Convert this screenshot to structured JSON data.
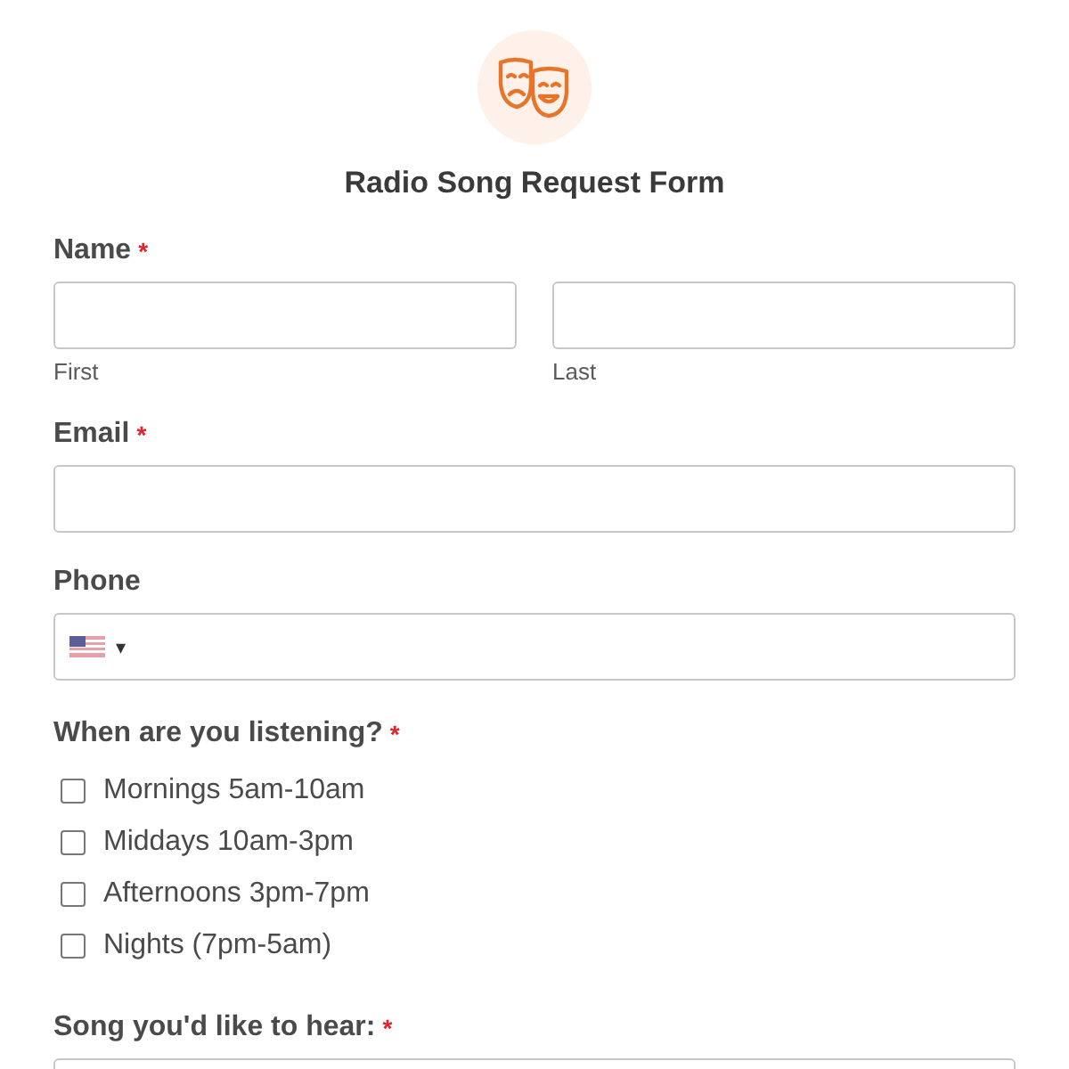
{
  "form": {
    "title": "Radio Song Request Form"
  },
  "fields": [
    {
      "kind": "name",
      "label": "Name",
      "required_mark": "*",
      "sublabels": [
        "First",
        "Last"
      ]
    },
    {
      "kind": "text",
      "label": "Email",
      "required_mark": "*"
    },
    {
      "kind": "phone",
      "label": "Phone",
      "country_caret": "▾"
    },
    {
      "kind": "checkboxes",
      "label": "When are you listening?",
      "required_mark": "*",
      "options": [
        {
          "label": "Mornings 5am-10am",
          "checked": false
        },
        {
          "label": "Middays 10am-3pm",
          "checked": false
        },
        {
          "label": "Afternoons 3pm-7pm",
          "checked": false
        },
        {
          "label": "Nights (7pm-5am)",
          "checked": false
        }
      ]
    },
    {
      "kind": "text",
      "label": "Song you'd like to hear:",
      "required_mark": "*"
    }
  ]
}
